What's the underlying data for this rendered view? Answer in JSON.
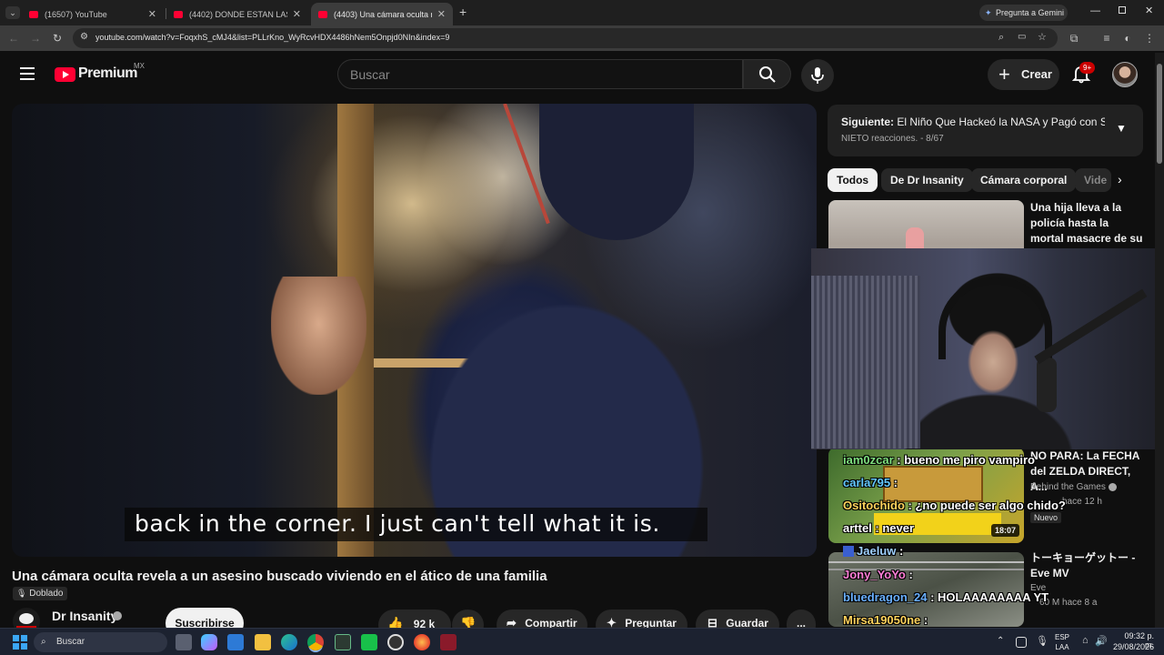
{
  "browser": {
    "tabs": [
      {
        "label": "(16507) YouTube",
        "active": false
      },
      {
        "label": "(4402) DONDE ESTAN LAS RUB",
        "active": false
      },
      {
        "label": "(4403) Una cámara oculta revel",
        "active": true
      }
    ],
    "new_tab_label": "+",
    "gemini_label": "Pregunta a Gemini",
    "url": "youtube.com/watch?v=FoqxhS_cMJ4&list=PLLrKno_WyRcvHDX4486hNem5Onpjd0NIn&index=9"
  },
  "masthead": {
    "logo_text": "Premium",
    "logo_country": "MX",
    "search_placeholder": "Buscar",
    "create_label": "Crear",
    "notification_badge": "9+"
  },
  "player": {
    "subtitle": "back in the corner. I just can't tell what it is."
  },
  "video": {
    "title": "Una cámara oculta revela a un asesino buscado viviendo en el ático de una familia",
    "dubbed_label": "Doblado",
    "channel_name": "Dr Insanity",
    "subscribe_label": "Suscribirse",
    "likes": "92 k",
    "share_label": "Compartir",
    "ask_label": "Preguntar",
    "save_label": "Guardar",
    "more_label": "..."
  },
  "up_next": {
    "prefix": "Siguiente:",
    "title": "El Niño Que Hackeó la NASA y Pagó con S...",
    "subtitle": "NIETO reacciones. - 8/67"
  },
  "chips": [
    "Todos",
    "De Dr Insanity",
    "Cámara corporal",
    "Vide"
  ],
  "recommendations": [
    {
      "title": "Una hija lleva a la policía hasta la mortal masacre de su padre",
      "channel": "",
      "meta": "",
      "duration": ""
    },
    {
      "title": "NO PARA: La FECHA del ZELDA DIRECT, A...",
      "channel": "Behind the Games",
      "meta": "hace 12 h",
      "badge": "Nuevo",
      "duration": "18:07"
    },
    {
      "title": "トーキョーゲットー - Eve MV",
      "channel": "Eve",
      "meta": "60 M   hace 8 a",
      "duration": ""
    }
  ],
  "chat": [
    {
      "user": "iam0zcar",
      "message": "bueno me piro vampiro",
      "color": "#7fe07f"
    },
    {
      "user": "carla795",
      "message": "",
      "color": "#64c8ff"
    },
    {
      "user": "Ositochido",
      "message": "¿no puede ser algo chido?",
      "color": "#ffd35c"
    },
    {
      "user": "arttel",
      "message": "never",
      "color": "#ffffff"
    },
    {
      "user": "Jaeluw",
      "message": "",
      "color": "#9fd0ff"
    },
    {
      "user": "Jony_YoYo",
      "message": "",
      "color": "#ff7fd6"
    },
    {
      "user": "bluedragon_24",
      "message": "HOLAAAAAAAA YT",
      "color": "#6ab0ff"
    },
    {
      "user": "Mirsa19050ne",
      "message": "",
      "color": "#ffd35c"
    }
  ],
  "taskbar": {
    "search_placeholder": "Buscar",
    "language": "ESP",
    "language_sub": "LAA",
    "time": "09:32 p. m.",
    "date": "29/08/2026"
  }
}
